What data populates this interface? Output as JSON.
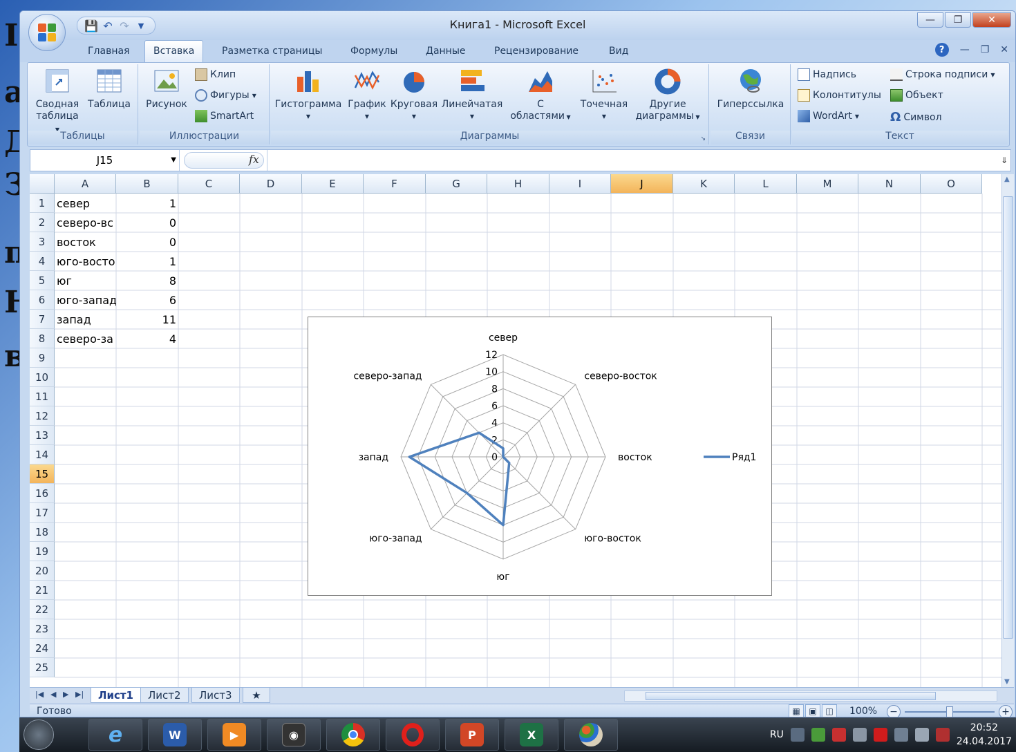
{
  "slide": {
    "chars": [
      "I",
      "a",
      "Д",
      "З",
      "п",
      "Н",
      "в"
    ]
  },
  "window": {
    "title": "Книга1 - Microsoft Excel"
  },
  "colors": {
    "accent": "#4f81bd",
    "selected_header": "#f3b45a",
    "ribbon": "#d7e5f6"
  },
  "tabs": [
    {
      "label": "Главная"
    },
    {
      "label": "Вставка",
      "active": true
    },
    {
      "label": "Разметка страницы"
    },
    {
      "label": "Формулы"
    },
    {
      "label": "Данные"
    },
    {
      "label": "Рецензирование"
    },
    {
      "label": "Вид"
    }
  ],
  "ribbon": {
    "tables": {
      "label": "Таблицы",
      "pivot_line1": "Сводная",
      "pivot_line2": "таблица",
      "table": "Таблица"
    },
    "illustrations": {
      "label": "Иллюстрации",
      "picture": "Рисунок",
      "clip": "Клип",
      "shapes": "Фигуры",
      "smartart": "SmartArt"
    },
    "charts": {
      "label": "Диаграммы",
      "column": "Гистограмма",
      "line": "График",
      "pie": "Круговая",
      "bar": "Линейчатая",
      "area_line1": "С",
      "area_line2": "областями",
      "scatter": "Точечная",
      "other_line1": "Другие",
      "other_line2": "диаграммы"
    },
    "links": {
      "label": "Связи",
      "hyperlink": "Гиперссылка"
    },
    "text": {
      "label": "Текст",
      "textbox": "Надпись",
      "header_footer": "Колонтитулы",
      "wordart": "WordArt",
      "signature": "Строка подписи",
      "object": "Объект",
      "symbol": "Символ"
    }
  },
  "formula_bar": {
    "name_box": "J15",
    "fx": "fx",
    "value": ""
  },
  "grid": {
    "columns": [
      "A",
      "B",
      "C",
      "D",
      "E",
      "F",
      "G",
      "H",
      "I",
      "J",
      "K",
      "L",
      "M",
      "N",
      "O"
    ],
    "selected_column": "J",
    "selected_row": 15,
    "rows": [
      "1",
      "2",
      "3",
      "4",
      "5",
      "6",
      "7",
      "8",
      "9",
      "10",
      "11",
      "12",
      "13",
      "14",
      "15",
      "16",
      "17",
      "18",
      "19",
      "20",
      "21",
      "22",
      "23",
      "24",
      "25"
    ],
    "cells": [
      {
        "a": "север",
        "b": "1"
      },
      {
        "a": "северо-вс",
        "b": "0"
      },
      {
        "a": "восток",
        "b": "0"
      },
      {
        "a": "юго-восто",
        "b": "1"
      },
      {
        "a": "юг",
        "b": "8"
      },
      {
        "a": "юго-запад",
        "b": "6"
      },
      {
        "a": "запад",
        "b": "11"
      },
      {
        "a": "северо-за",
        "b": "4"
      }
    ]
  },
  "chart_data": {
    "type": "radar",
    "categories": [
      "север",
      "северо-восток",
      "восток",
      "юго-восток",
      "юг",
      "юго-запад",
      "запад",
      "северо-запад"
    ],
    "series": [
      {
        "name": "Ряд1",
        "values": [
          1,
          0,
          0,
          1,
          8,
          6,
          11,
          4
        ]
      }
    ],
    "axis_ticks": [
      "0",
      "2",
      "4",
      "6",
      "8",
      "10",
      "12"
    ],
    "rlim": [
      0,
      12
    ],
    "legend": "right",
    "color": "#4f81bd"
  },
  "sheets": [
    {
      "label": "Лист1",
      "active": true
    },
    {
      "label": "Лист2"
    },
    {
      "label": "Лист3"
    }
  ],
  "status": {
    "text": "Готово",
    "zoom": "100%"
  },
  "taskbar": {
    "lang": "RU",
    "time": "20:52",
    "date": "24.04.2017"
  }
}
